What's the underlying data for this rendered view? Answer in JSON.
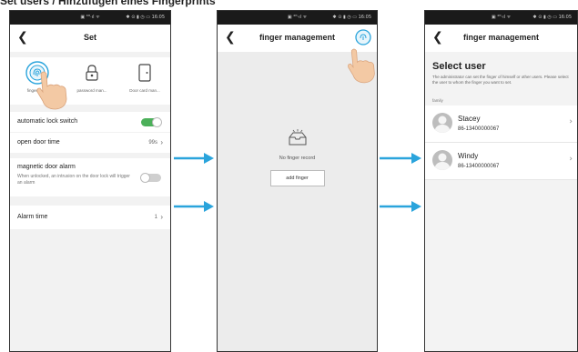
{
  "heading": "Set users / Hinzufügen eines Fingerprints",
  "status": {
    "mid": "▣ ⁴ᴳ·ıl ᯤ",
    "right": "✱ ⊙ ▮ ◷ ▭ 16:05"
  },
  "screen1": {
    "title": "Set",
    "tiles": [
      "finger ma...",
      "password man...",
      "Door card man..."
    ],
    "auto_lock": "automatic lock switch",
    "open_door_time": "open door time",
    "open_door_value": "99s",
    "mag_alarm": "magnetic door alarm",
    "mag_alarm_desc": "When unlocked, an intrusion on the door lock will trigger an alarm",
    "alarm_time": "Alarm time",
    "alarm_value": "1"
  },
  "screen2": {
    "title": "finger management",
    "empty_msg": "No finger record",
    "add_button": "add finger"
  },
  "screen3": {
    "title": "finger management",
    "select_title": "Select user",
    "description": "The administrator can set the finger of himself or other users. Please select the user to whom the finger you want to set.",
    "group": "family",
    "users": [
      {
        "name": "Stacey",
        "phone": "86-13400000067"
      },
      {
        "name": "Windy",
        "phone": "86-13400000067"
      }
    ]
  },
  "colors": {
    "accent": "#2aa4dc",
    "toggle_on": "#4cb05a"
  }
}
